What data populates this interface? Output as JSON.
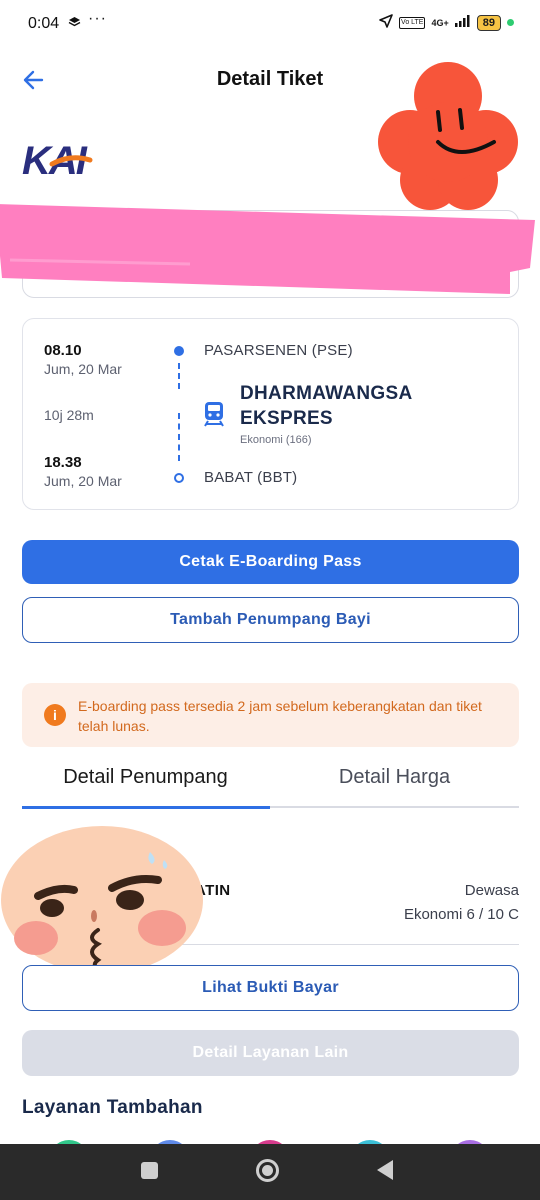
{
  "status_bar": {
    "time": "0:04",
    "dots": "···",
    "network": "4G+",
    "lte": "Vo LTE",
    "battery": "89"
  },
  "header": {
    "title": "Detail Tiket"
  },
  "logo": {
    "text": "KAI",
    "color": "#2a2e7e",
    "accent": "#f07a1e"
  },
  "journey": {
    "departure": {
      "time": "08.10",
      "date": "Jum, 20 Mar",
      "station": "PASARSENEN (PSE)"
    },
    "duration": "10j 28m",
    "arrival": {
      "time": "18.38",
      "date": "Jum, 20 Mar",
      "station": "BABAT (BBT)"
    },
    "train": {
      "name_line1": "DHARMAWANGSA",
      "name_line2": "EKSPRES",
      "class": "Ekonomi (166)"
    }
  },
  "actions": {
    "print_pass": "Cetak E-Boarding Pass",
    "add_infant": "Tambah Penumpang Bayi"
  },
  "info": {
    "text": "E-boarding pass tersedia 2 jam sebelum keberangkatan dan tiket telah lunas."
  },
  "tabs": [
    {
      "label": "Detail Penumpang",
      "active": true
    },
    {
      "label": "Detail Harga",
      "active": false
    }
  ],
  "passenger": {
    "name_partial": "YATIN",
    "type": "Dewasa",
    "seat": "Ekonomi 6 / 10 C"
  },
  "buttons": {
    "payment_proof": "Lihat Bukti Bayar",
    "other_services": "Detail Layanan Lain"
  },
  "section": {
    "title": "Layanan Tambahan"
  },
  "colors": {
    "primary": "#2f6fe4",
    "outline": "#2b5bb5",
    "info_bg": "#fdeee6",
    "info_text": "#d2691e",
    "sticker_flower": "#f7553a",
    "sticker_band": "#ff7fc0",
    "sticker_face": "#fbd0b4"
  }
}
